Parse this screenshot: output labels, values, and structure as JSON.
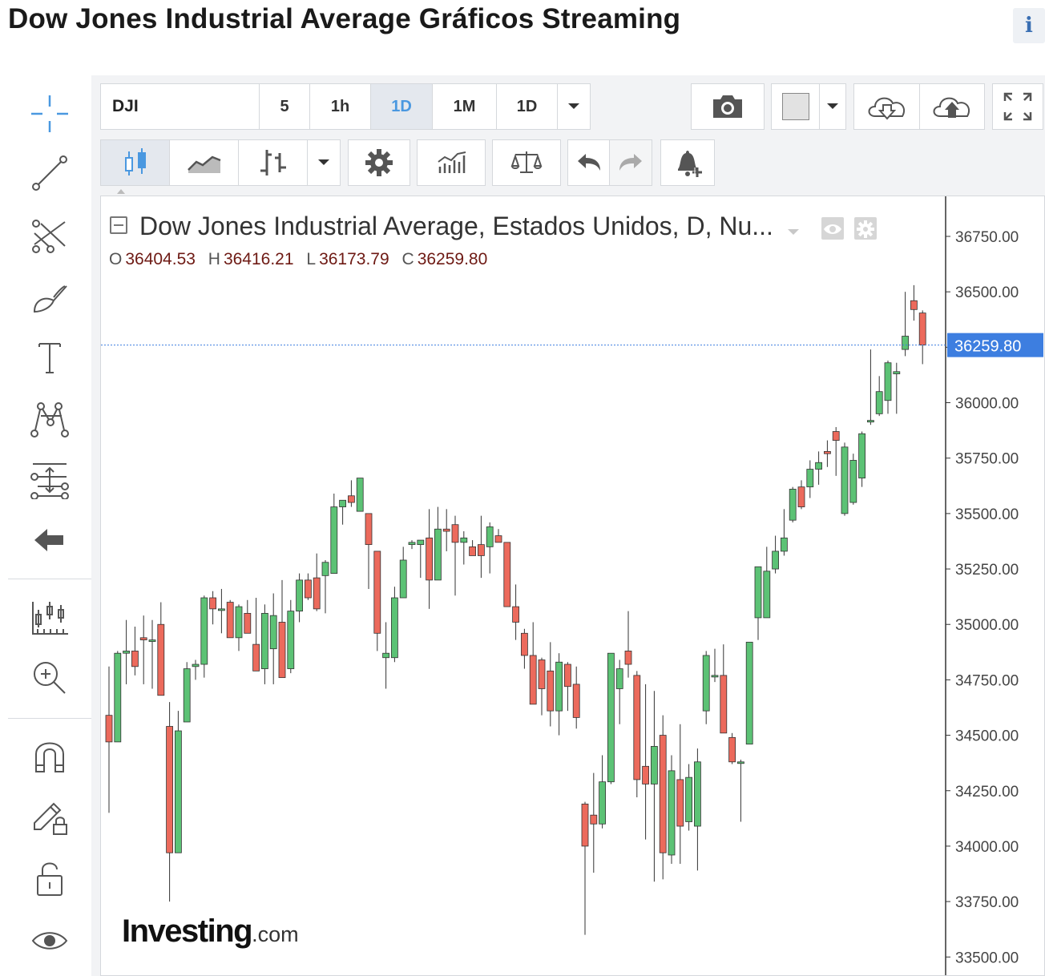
{
  "page": {
    "title": "Dow Jones Industrial Average Gráficos Streaming",
    "info_label": "i"
  },
  "toolbar_top": {
    "symbol": "DJI",
    "intervals": [
      {
        "label": "5",
        "active": false
      },
      {
        "label": "1h",
        "active": false
      },
      {
        "label": "1D",
        "active": true
      },
      {
        "label": "1M",
        "active": false
      },
      {
        "label": "1D",
        "active": false
      }
    ],
    "dropdown_icon": "chevron-down-icon",
    "snapshot_icon": "camera-icon",
    "color_swatch": "#e2e2e2",
    "save_icon": "cloud-download-icon",
    "load_icon": "cloud-upload-icon",
    "fullscreen_icon": "fullscreen-icon"
  },
  "toolbar_second": {
    "icons": [
      "candles-icon",
      "area-chart-icon",
      "bars-icon",
      "chevron-down-icon",
      "gear-icon",
      "indicators-icon",
      "compare-scale-icon",
      "undo-icon",
      "redo-icon",
      "alert-bell-plus-icon"
    ]
  },
  "left_tools": {
    "icons": [
      "crosshair-icon",
      "trend-line-icon",
      "pitchfork-icon",
      "brush-icon",
      "text-icon",
      "pattern-icon",
      "fibonacci-icon",
      "back-arrow-icon",
      "measure-icon",
      "zoom-in-icon",
      "magnet-icon",
      "lock-drawing-icon",
      "unlock-icon",
      "eye-icon"
    ]
  },
  "legend": {
    "title": "Dow Jones Industrial Average, Estados Unidos, D, Nu...",
    "o_label": "O",
    "o": "36404.53",
    "h_label": "H",
    "h": "36416.21",
    "l_label": "L",
    "l": "36173.79",
    "c_label": "C",
    "c": "36259.80"
  },
  "logo": {
    "brand": "Investing",
    "domain": ".com"
  },
  "colors": {
    "up": "#5cc275",
    "down": "#ec6a5c",
    "price_label_bg": "#3d7ee0",
    "price_line": "#3d7ee0"
  },
  "chart_data": {
    "type": "candlestick",
    "y_ticks": [
      "36750.00",
      "36500.00",
      "36250.00",
      "36000.00",
      "35750.00",
      "35500.00",
      "35250.00",
      "35000.00",
      "34750.00",
      "34500.00",
      "34250.00",
      "34000.00",
      "33750.00",
      "33500.00"
    ],
    "ylim": [
      33480,
      36870
    ],
    "last_price": 36259.8,
    "last_price_label": "36259.80",
    "candles": [
      [
        34590,
        34810,
        34150,
        34470
      ],
      [
        34470,
        34880,
        34470,
        34870
      ],
      [
        34870,
        35020,
        34730,
        34880
      ],
      [
        34880,
        34990,
        34770,
        34810
      ],
      [
        34940,
        35040,
        34730,
        34930
      ],
      [
        34930,
        35020,
        34710,
        34930
      ],
      [
        35000,
        35100,
        34680,
        34680
      ],
      [
        34540,
        34650,
        33750,
        33970
      ],
      [
        33970,
        34610,
        33970,
        34520
      ],
      [
        34560,
        34830,
        34560,
        34800
      ],
      [
        34810,
        34840,
        34750,
        34820
      ],
      [
        34820,
        35130,
        34760,
        35120
      ],
      [
        35120,
        35150,
        35000,
        35070
      ],
      [
        35070,
        35160,
        34960,
        35070
      ],
      [
        35100,
        35110,
        34960,
        34940
      ],
      [
        34940,
        35090,
        34880,
        35080
      ],
      [
        35050,
        35110,
        34970,
        34960
      ],
      [
        34910,
        35120,
        34800,
        34790
      ],
      [
        34800,
        35090,
        34730,
        35050
      ],
      [
        34890,
        35140,
        34730,
        35040
      ],
      [
        35010,
        35200,
        34770,
        34760
      ],
      [
        34800,
        35110,
        34780,
        35060
      ],
      [
        35060,
        35230,
        35010,
        35200
      ],
      [
        35200,
        35230,
        35110,
        35120
      ],
      [
        35210,
        35320,
        35060,
        35070
      ],
      [
        35220,
        35290,
        35050,
        35280
      ],
      [
        35230,
        35590,
        35230,
        35530
      ],
      [
        35530,
        35540,
        35450,
        35560
      ],
      [
        35580,
        35650,
        35530,
        35550
      ],
      [
        35510,
        35640,
        35510,
        35660
      ],
      [
        35500,
        35480,
        35160,
        35360
      ],
      [
        35330,
        35260,
        34880,
        34960
      ],
      [
        34850,
        35010,
        34710,
        34870
      ],
      [
        34850,
        35170,
        34830,
        35120
      ],
      [
        35120,
        35350,
        35120,
        35290
      ],
      [
        35360,
        35380,
        35340,
        35370
      ],
      [
        35360,
        35370,
        35210,
        35380
      ],
      [
        35390,
        35520,
        35070,
        35200
      ],
      [
        35200,
        35530,
        35200,
        35430
      ],
      [
        35430,
        35520,
        35330,
        35420
      ],
      [
        35450,
        35490,
        35130,
        35370
      ],
      [
        35370,
        35420,
        35270,
        35390
      ],
      [
        35350,
        35380,
        35330,
        35310
      ],
      [
        35360,
        35490,
        35210,
        35310
      ],
      [
        35350,
        35460,
        35230,
        35440
      ],
      [
        35400,
        35430,
        35370,
        35370
      ],
      [
        35370,
        35360,
        35110,
        35080
      ],
      [
        35080,
        35180,
        34930,
        35010
      ],
      [
        34960,
        34980,
        34800,
        34860
      ],
      [
        34860,
        35010,
        34640,
        34640
      ],
      [
        34840,
        34850,
        34590,
        34710
      ],
      [
        34790,
        34920,
        34540,
        34610
      ],
      [
        34610,
        34870,
        34500,
        34830
      ],
      [
        34820,
        34830,
        34610,
        34720
      ],
      [
        34730,
        34810,
        34530,
        34580
      ],
      [
        34190,
        34200,
        33600,
        34000
      ],
      [
        34140,
        34330,
        33880,
        34100
      ],
      [
        34100,
        34410,
        34080,
        34290
      ],
      [
        34290,
        34850,
        34280,
        34870
      ],
      [
        34710,
        34840,
        34550,
        34800
      ],
      [
        34880,
        35060,
        34760,
        34820
      ],
      [
        34770,
        34790,
        34220,
        34300
      ],
      [
        34360,
        34730,
        34030,
        34280
      ],
      [
        34280,
        34700,
        33840,
        34450
      ],
      [
        34500,
        34590,
        33850,
        33970
      ],
      [
        33960,
        34410,
        33920,
        34340
      ],
      [
        34300,
        34550,
        33920,
        34090
      ],
      [
        34110,
        34370,
        34070,
        34310
      ],
      [
        34090,
        34440,
        33890,
        34380
      ],
      [
        34610,
        34880,
        34550,
        34860
      ],
      [
        34770,
        34890,
        34740,
        34770
      ],
      [
        34770,
        34910,
        34580,
        34510
      ],
      [
        34490,
        34510,
        34370,
        34380
      ],
      [
        34380,
        34390,
        34110,
        34380
      ],
      [
        34460,
        34910,
        34460,
        34920
      ],
      [
        35030,
        35100,
        34930,
        35260
      ],
      [
        35030,
        35350,
        35030,
        35240
      ],
      [
        35250,
        35400,
        35230,
        35330
      ],
      [
        35330,
        35520,
        35310,
        35390
      ],
      [
        35470,
        35620,
        35460,
        35610
      ],
      [
        35620,
        35650,
        35520,
        35530
      ],
      [
        35620,
        35740,
        35570,
        35700
      ],
      [
        35700,
        35780,
        35630,
        35730
      ],
      [
        35780,
        35830,
        35710,
        35770
      ],
      [
        35870,
        35890,
        35670,
        35830
      ],
      [
        35500,
        35820,
        35490,
        35800
      ],
      [
        35550,
        35770,
        35540,
        35740
      ],
      [
        35660,
        35870,
        35620,
        35860
      ],
      [
        35920,
        36240,
        35900,
        35920
      ],
      [
        35950,
        36120,
        35940,
        36050
      ],
      [
        36010,
        36190,
        35950,
        36180
      ],
      [
        36130,
        36180,
        35950,
        36140
      ],
      [
        36240,
        36500,
        36210,
        36300
      ],
      [
        36460,
        36530,
        36370,
        36420
      ],
      [
        36404.53,
        36416.21,
        36173.79,
        36259.8
      ]
    ]
  }
}
